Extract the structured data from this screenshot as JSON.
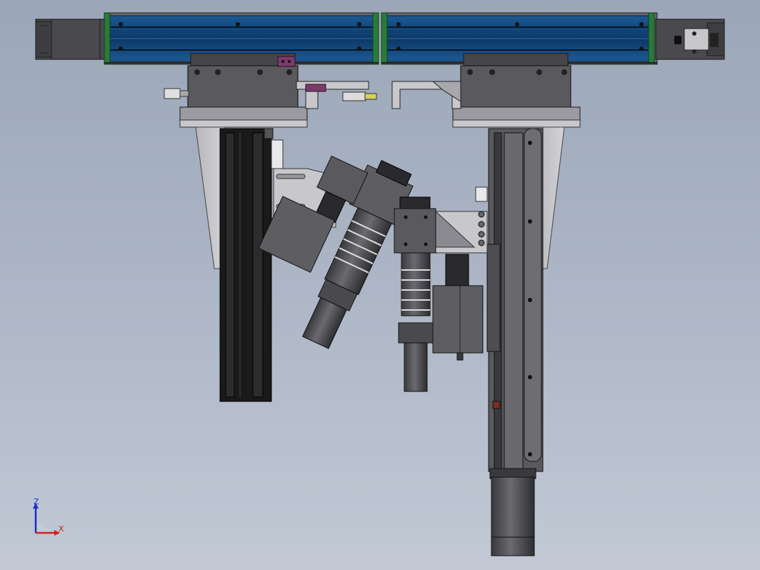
{
  "viewport": {
    "background_top": "#9ba6b8",
    "background_bottom": "#c2c9d5"
  },
  "colors": {
    "rail_blue": "#0e3e6e",
    "end_cap_green": "#2a7a3a",
    "body_gray": "#5a5a5e",
    "plate_light": "#c8c8cc",
    "dark_profile": "#1a1a1a",
    "bracket_purple": "#7a3a6a"
  },
  "triad": {
    "z_label": "Z",
    "x_label": "X",
    "z_color": "#1a2cd0",
    "x_color": "#d02020"
  }
}
